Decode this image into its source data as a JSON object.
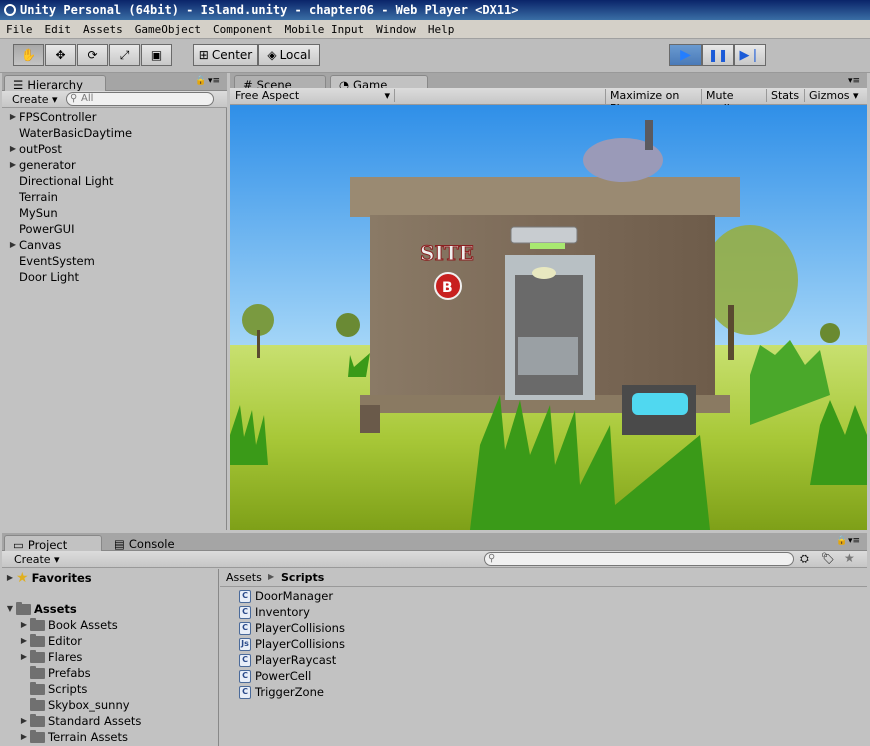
{
  "window": {
    "title": "Unity Personal (64bit) - Island.unity - chapter06 - Web Player <DX11>"
  },
  "menu": [
    "File",
    "Edit",
    "Assets",
    "GameObject",
    "Component",
    "Mobile Input",
    "Window",
    "Help"
  ],
  "toolbar": {
    "center": "Center",
    "local": "Local"
  },
  "hierarchy": {
    "tab": "Hierarchy",
    "create": "Create",
    "search_placeholder": "All",
    "items": [
      {
        "label": "FPSController",
        "expandable": true
      },
      {
        "label": "WaterBasicDaytime",
        "expandable": false
      },
      {
        "label": "outPost",
        "expandable": true
      },
      {
        "label": "generator",
        "expandable": true
      },
      {
        "label": "Directional Light",
        "expandable": false
      },
      {
        "label": "Terrain",
        "expandable": false
      },
      {
        "label": "MySun",
        "expandable": false
      },
      {
        "label": "PowerGUI",
        "expandable": false
      },
      {
        "label": "Canvas",
        "expandable": true
      },
      {
        "label": "EventSystem",
        "expandable": false
      },
      {
        "label": "Door Light",
        "expandable": false
      }
    ]
  },
  "game": {
    "scene_tab": "Scene",
    "game_tab": "Game",
    "aspect": "Free Aspect",
    "maximize": "Maximize on Play",
    "mute": "Mute audio",
    "stats": "Stats",
    "gizmos": "Gizmos"
  },
  "project": {
    "tab": "Project",
    "console_tab": "Console",
    "create": "Create",
    "favorites": "Favorites",
    "assets": "Assets",
    "folders": [
      {
        "label": "Book Assets",
        "expandable": true
      },
      {
        "label": "Editor",
        "expandable": true
      },
      {
        "label": "Flares",
        "expandable": true
      },
      {
        "label": "Prefabs",
        "expandable": false
      },
      {
        "label": "Scripts",
        "expandable": false
      },
      {
        "label": "Skybox_sunny",
        "expandable": false
      },
      {
        "label": "Standard Assets",
        "expandable": true
      },
      {
        "label": "Terrain Assets",
        "expandable": true
      }
    ],
    "breadcrumb": {
      "root": "Assets",
      "sep": "▶",
      "current": "Scripts"
    },
    "scripts": [
      {
        "label": "DoorManager",
        "type": "C#"
      },
      {
        "label": "Inventory",
        "type": "C#"
      },
      {
        "label": "PlayerCollisions",
        "type": "C#"
      },
      {
        "label": "PlayerCollisions",
        "type": "JS"
      },
      {
        "label": "PlayerRaycast",
        "type": "C#"
      },
      {
        "label": "PowerCell",
        "type": "C#"
      },
      {
        "label": "TriggerZone",
        "type": "C#"
      }
    ]
  },
  "scene_text": {
    "site": "SITE",
    "badge": "B"
  }
}
